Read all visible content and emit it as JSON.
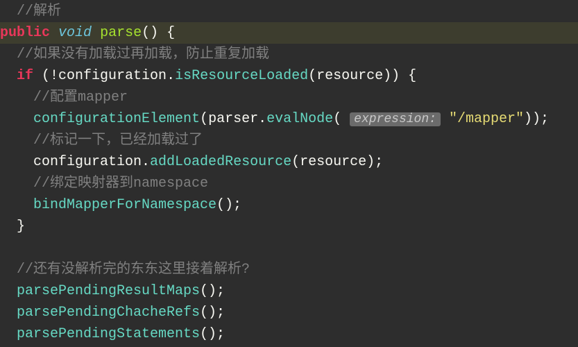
{
  "comments": {
    "c0": "//解析",
    "c1": "//如果没有加载过再加载，防止重复加载",
    "c2": "//配置mapper",
    "c3": "//标记一下，已经加载过了",
    "c4": "//绑定映射器到namespace",
    "c5": "//还有没解析完的东东这里接着解析?"
  },
  "kw": {
    "public": "public",
    "void": "void",
    "if": "if"
  },
  "ident": {
    "parse": "parse",
    "configuration": "configuration",
    "isResourceLoaded": "isResourceLoaded",
    "resource": "resource",
    "configurationElement": "configurationElement",
    "parser": "parser",
    "evalNode": "evalNode",
    "addLoadedResource": "addLoadedResource",
    "bindMapperForNamespace": "bindMapperForNamespace",
    "parsePendingResultMaps": "parsePendingResultMaps",
    "parsePendingChacheRefs": "parsePendingChacheRefs",
    "parsePendingStatements": "parsePendingStatements"
  },
  "hint": {
    "expression": "expression:"
  },
  "lit": {
    "mapper": "\"/mapper\""
  },
  "punc": {
    "parenEmpty": "()",
    "spaceBrace": " {",
    "spaceParenBang": " (!",
    "dot": ".",
    "lparen": "(",
    "rparen": ")",
    "rparenSpaceBrace": ") {",
    "rparenSemi": ");",
    "doubleRparenSemi": "));",
    "semiAfterParen": "();",
    "rbrace": "}"
  }
}
